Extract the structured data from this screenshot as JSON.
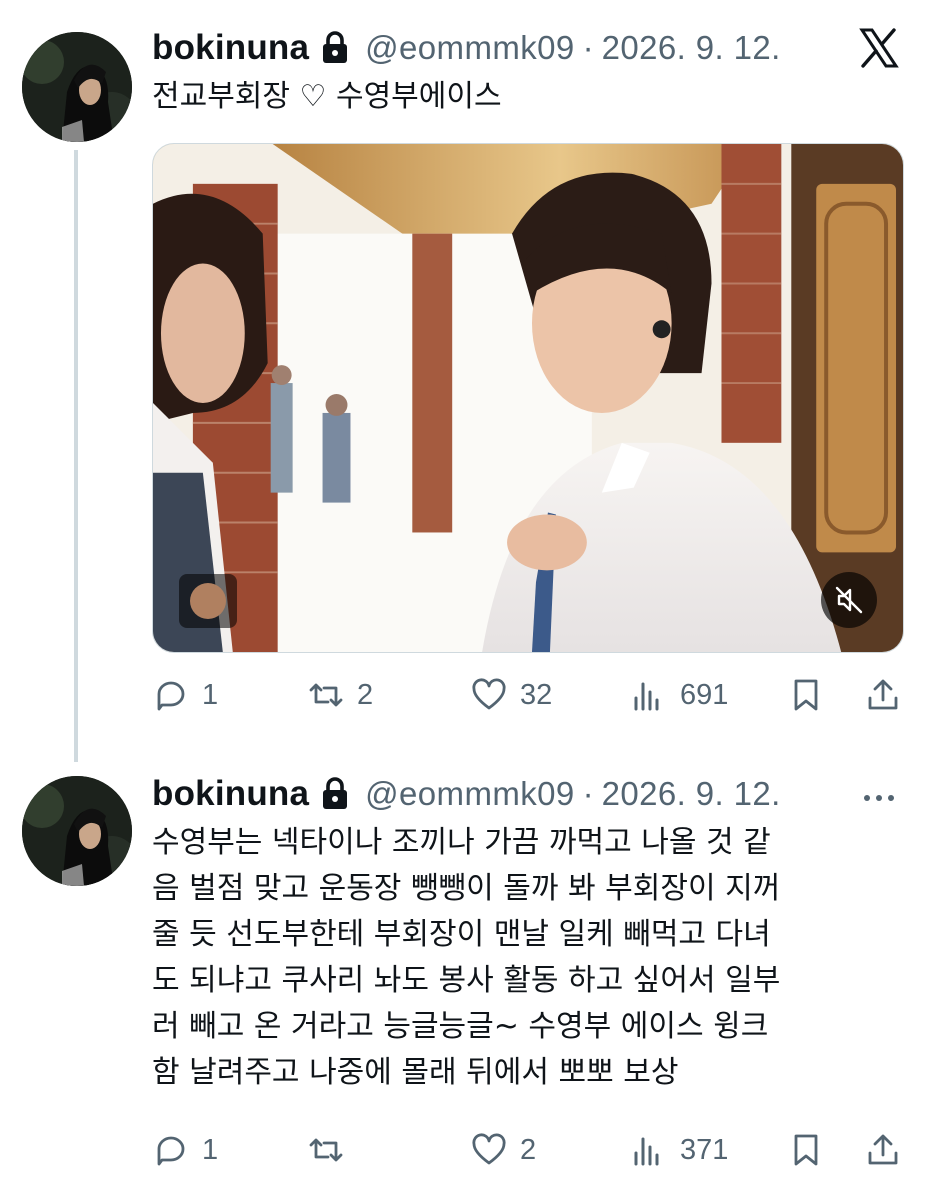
{
  "tweets": [
    {
      "display_name": "bokinuna",
      "handle": "@eommmk09",
      "separator": "·",
      "date": "2026. 9. 12.",
      "text": "전교부회장 ♡ 수영부에이스",
      "stats": {
        "replies": "1",
        "reposts": "2",
        "likes": "32",
        "views": "691"
      }
    },
    {
      "display_name": "bokinuna",
      "handle": "@eommmk09",
      "separator": "·",
      "date": "2026. 9. 12.",
      "text": "수영부는 넥타이나 조끼나 가끔 까먹고 나올 것 같\n음 벌점 맞고 운동장 뺑뺑이 돌까 봐 부회장이 지꺼\n줄 듯 선도부한테 부회장이 맨날 일케 빼먹고 다녀\n도 되냐고 쿠사리 놔도 봉사 활동 하고 싶어서 일부\n러 빼고 온 거라고 능글능글~ 수영부 에이스 윙크\n함 날려주고 나중에 몰래 뒤에서 뽀뽀 보상",
      "stats": {
        "replies": "1",
        "reposts": "",
        "likes": "2",
        "views": "371"
      }
    }
  ],
  "colors": {
    "text_primary": "#0f1419",
    "text_secondary": "#536471",
    "thread_line": "#cfd9de",
    "background": "#ffffff"
  },
  "icons": {
    "protected": "lock-icon",
    "platform": "x-logo-icon",
    "more": "more-dots-icon",
    "reply": "reply-icon",
    "repost": "repost-icon",
    "like": "heart-icon",
    "views": "views-icon",
    "bookmark": "bookmark-icon",
    "share": "share-icon",
    "mute": "mute-icon"
  }
}
